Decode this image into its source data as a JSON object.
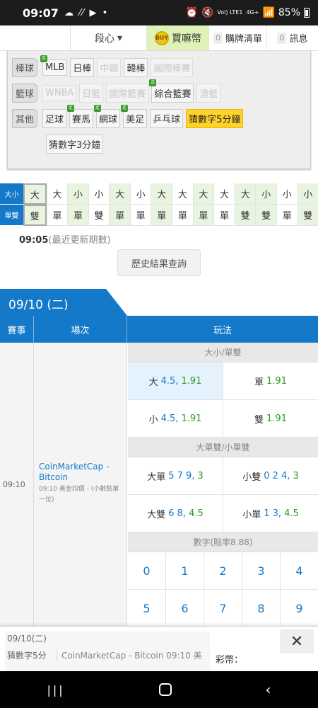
{
  "status": {
    "time": "09:07",
    "left_icons": "☁ ⁄⁄ ▶ •",
    "net": "Vol) LTE1",
    "net2": "4G+",
    "battery": "85%"
  },
  "nav": {
    "dan": "段心",
    "buy": "買嘛幣",
    "coin": "BUY",
    "cart_count": "0",
    "cart": "購牌清單",
    "msg_count": "0",
    "msg": "訊息"
  },
  "sports": {
    "rows": [
      {
        "tag": "棒球",
        "items": [
          {
            "label": "MLB",
            "zou": true,
            "state": "normal"
          },
          {
            "label": "日棒",
            "state": "normal"
          },
          {
            "label": "中職",
            "state": "dis"
          },
          {
            "label": "韓棒",
            "state": "normal"
          },
          {
            "label": "國際棒賽",
            "state": "dis"
          }
        ]
      },
      {
        "tag": "籃球",
        "items": [
          {
            "label": "WNBA",
            "state": "dis"
          },
          {
            "label": "日籃",
            "state": "dis"
          },
          {
            "label": "國際籃賽",
            "state": "dis"
          },
          {
            "label": "綜合籃賽",
            "zou": true,
            "state": "normal"
          },
          {
            "label": "澳籃",
            "state": "dis"
          }
        ]
      },
      {
        "tag": "其他",
        "items": [
          {
            "label": "足球",
            "state": "normal"
          },
          {
            "label": "賽馬",
            "zou": true,
            "state": "normal"
          },
          {
            "label": "網球",
            "zou": true,
            "state": "normal"
          },
          {
            "label": "美足",
            "zou": true,
            "state": "normal"
          },
          {
            "label": "乒乓球",
            "state": "normal"
          },
          {
            "label": "猜數字5分鐘",
            "state": "sel"
          }
        ]
      },
      {
        "tag": "",
        "items": [
          {
            "label": "猜數字3分鐘",
            "state": "normal"
          }
        ]
      }
    ],
    "zou_label": "走"
  },
  "results": {
    "row1_label": "大小",
    "row1": [
      "大",
      "大",
      "小",
      "小",
      "大",
      "小",
      "大",
      "大",
      "大",
      "大",
      "大",
      "小",
      "小",
      "小"
    ],
    "row2_label": "單雙",
    "row2": [
      "雙",
      "單",
      "單",
      "雙",
      "單",
      "單",
      "單",
      "單",
      "單",
      "單",
      "雙",
      "雙",
      "單",
      "雙"
    ],
    "bg": [
      "g",
      "w",
      "g",
      "w",
      "g",
      "w",
      "g",
      "w",
      "g",
      "w",
      "g",
      "g",
      "w",
      "g"
    ]
  },
  "update": {
    "time": "09:05",
    "note": "(最近更新期數)"
  },
  "history_button": "歷史結果查詢",
  "date_tab": "09/10 (二)",
  "table_head": {
    "c1": "賽事",
    "c2": "場次",
    "c3": "玩法"
  },
  "game": {
    "time": "09:10",
    "name": "CoinMarketCap - Bitcoin",
    "desc": "09:10 美金均價 - (小數點第一位)"
  },
  "sections": {
    "s1": "大小/單雙",
    "s2": "大單雙/小單雙",
    "s3": "數字(賠率8.88)"
  },
  "odds": {
    "big": {
      "label": "大",
      "num": "4.5,",
      "odd": "1.91"
    },
    "odd_single": {
      "label": "單",
      "odd": "1.91"
    },
    "small": {
      "label": "小",
      "num": "4.5,",
      "odd": "1.91"
    },
    "even": {
      "label": "雙",
      "odd": "1.91"
    },
    "big_single": {
      "label": "大單",
      "num": "5 7 9,",
      "odd": "3"
    },
    "small_even": {
      "label": "小雙",
      "num": "0 2 4,",
      "odd": "3"
    },
    "big_even": {
      "label": "大雙",
      "num": "6 8,",
      "odd": "4.5"
    },
    "small_single": {
      "label": "小單",
      "num": "1 3,",
      "odd": "4.5"
    }
  },
  "numbers": [
    "0",
    "1",
    "2",
    "3",
    "4",
    "5",
    "6",
    "7",
    "8",
    "9"
  ],
  "slip": {
    "date": "09/10(二)",
    "game": "猜數字5分",
    "desc": "CoinMarketCap - Bitcoin 09:10 美金",
    "label": "彩幣：",
    "close": "✕"
  },
  "android_nav": {
    "recent": "|||",
    "back": "‹"
  }
}
